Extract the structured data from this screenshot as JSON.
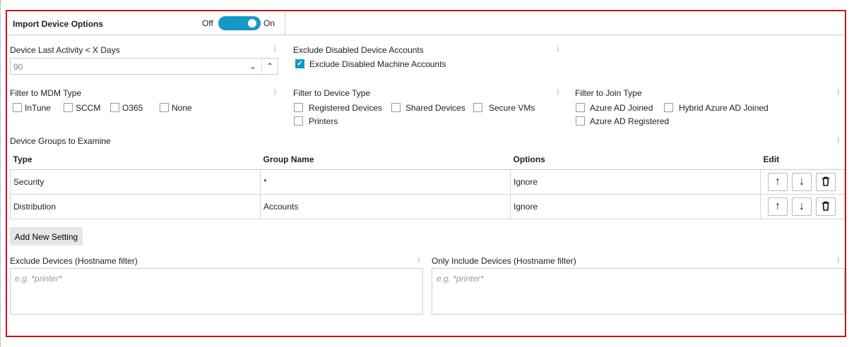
{
  "header": {
    "title": "Import Device Options",
    "toggle_off_label": "Off",
    "toggle_on_label": "On",
    "toggle_state": "on"
  },
  "activity": {
    "label": "Device Last Activity < X Days",
    "value": "90"
  },
  "exclude_disabled": {
    "label": "Exclude Disabled Device Accounts",
    "checkbox_label": "Exclude Disabled Machine Accounts",
    "checked": true
  },
  "mdm": {
    "label": "Filter to MDM Type",
    "options": [
      "InTune",
      "SCCM",
      "O365",
      "None"
    ]
  },
  "device_type": {
    "label": "Filter to Device Type",
    "options": [
      "Registered Devices",
      "Shared Devices",
      "Secure VMs",
      "Printers"
    ]
  },
  "join_type": {
    "label": "Filter to Join Type",
    "options": [
      "Azure AD Joined",
      "Hybrid Azure AD Joined",
      "Azure AD Registered"
    ]
  },
  "groups": {
    "label": "Device Groups to Examine",
    "columns": [
      "Type",
      "Group Name",
      "Options",
      "Edit"
    ],
    "rows": [
      {
        "type": "Security",
        "group": "*",
        "option": "Ignore"
      },
      {
        "type": "Distribution",
        "group": "Accounts",
        "option": "Ignore"
      }
    ],
    "add_button": "Add New Setting"
  },
  "exclude_hosts": {
    "label": "Exclude Devices (Hostname filter)",
    "placeholder": "e.g. *printer*"
  },
  "include_hosts": {
    "label": "Only Include Devices (Hostname filter)",
    "placeholder": "e.g. *printer*"
  },
  "info_glyph": "i",
  "icons": {
    "up": "↑",
    "down": "↓",
    "spin_down": "⌄",
    "spin_up": "⌃",
    "check": "✓"
  },
  "colors": {
    "frame": "#c8151c",
    "accent": "#1599c4"
  }
}
